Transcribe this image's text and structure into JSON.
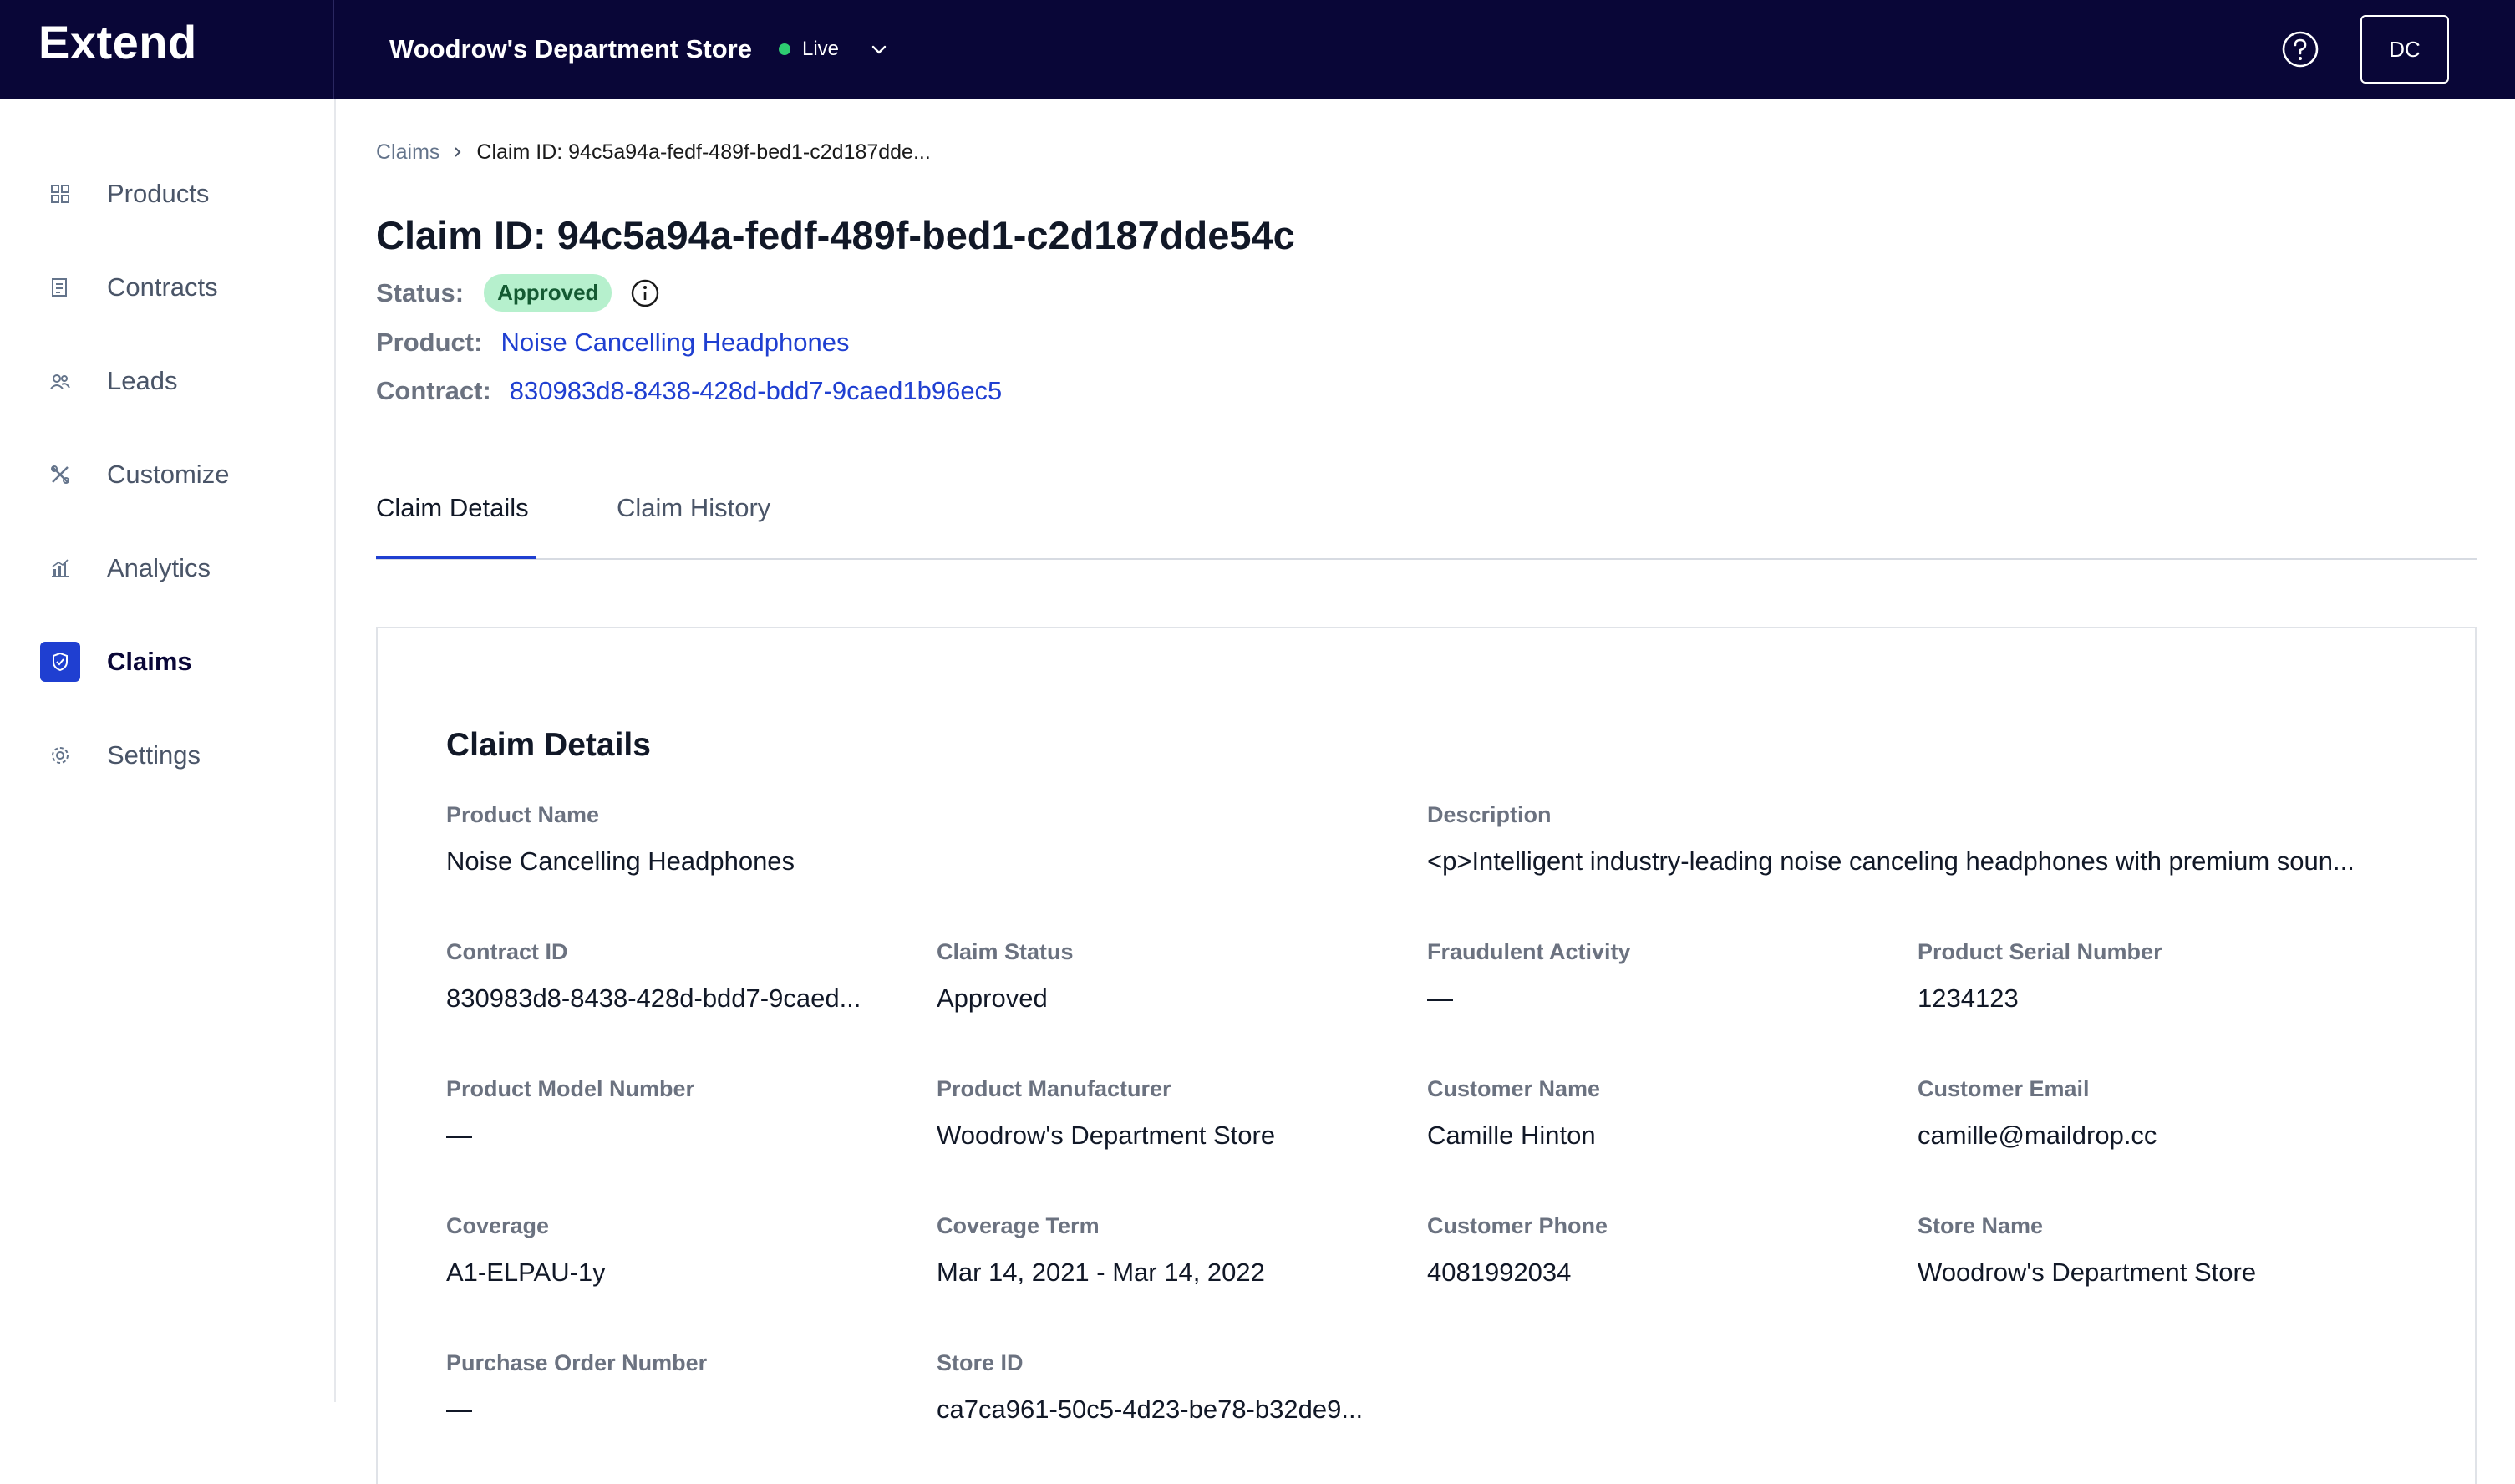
{
  "header": {
    "brand": "Extend",
    "store_name": "Woodrow's Department Store",
    "env_status": "Live",
    "user_initials": "DC"
  },
  "sidebar": {
    "items": [
      {
        "label": "Products",
        "icon": "grid-icon"
      },
      {
        "label": "Contracts",
        "icon": "document-icon"
      },
      {
        "label": "Leads",
        "icon": "people-icon"
      },
      {
        "label": "Customize",
        "icon": "tools-icon"
      },
      {
        "label": "Analytics",
        "icon": "chart-icon"
      },
      {
        "label": "Claims",
        "icon": "shield-icon",
        "active": true
      },
      {
        "label": "Settings",
        "icon": "gear-icon"
      }
    ]
  },
  "breadcrumb": {
    "parent": "Claims",
    "current": "Claim ID: 94c5a94a-fedf-489f-bed1-c2d187dde..."
  },
  "page": {
    "title": "Claim ID: 94c5a94a-fedf-489f-bed1-c2d187dde54c",
    "status_label": "Status:",
    "status_value": "Approved",
    "product_label": "Product:",
    "product_value": "Noise Cancelling Headphones",
    "contract_label": "Contract:",
    "contract_value": "830983d8-8438-428d-bdd7-9caed1b96ec5"
  },
  "tabs": [
    {
      "label": "Claim Details",
      "active": true
    },
    {
      "label": "Claim History",
      "active": false
    }
  ],
  "details": {
    "title": "Claim Details",
    "fields": [
      {
        "label": "Product Name",
        "value": "Noise Cancelling Headphones"
      },
      {
        "label": "Description",
        "value": "<p>Intelligent industry-leading noise canceling headphones with premium soun..."
      },
      {
        "label": "Contract ID",
        "value": "830983d8-8438-428d-bdd7-9caed..."
      },
      {
        "label": "Claim Status",
        "value": "Approved"
      },
      {
        "label": "Fraudulent Activity",
        "value": "—"
      },
      {
        "label": "Product Serial Number",
        "value": "1234123"
      },
      {
        "label": "Product Model Number",
        "value": "—"
      },
      {
        "label": "Product Manufacturer",
        "value": "Woodrow's Department Store"
      },
      {
        "label": "Customer Name",
        "value": "Camille Hinton"
      },
      {
        "label": "Customer Email",
        "value": "camille@maildrop.cc"
      },
      {
        "label": "Coverage",
        "value": "A1-ELPAU-1y"
      },
      {
        "label": "Coverage Term",
        "value": "Mar 14, 2021 - Mar 14, 2022"
      },
      {
        "label": "Customer Phone",
        "value": "4081992034"
      },
      {
        "label": "Store Name",
        "value": "Woodrow's Department Store"
      },
      {
        "label": "Purchase Order Number",
        "value": "—"
      },
      {
        "label": "Store ID",
        "value": "ca7ca961-50c5-4d23-be78-b32de9..."
      }
    ]
  },
  "colors": {
    "topbar": "#090637",
    "accent": "#1f3fd1",
    "status_badge_bg": "#b6f0cd",
    "live_dot": "#2ecc71"
  }
}
